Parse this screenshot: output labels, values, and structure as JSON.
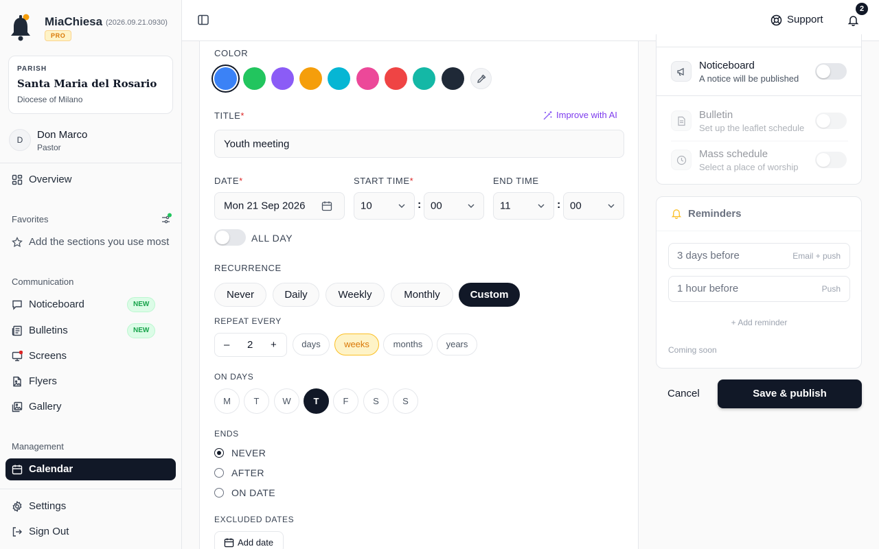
{
  "app": {
    "name": "MiaChiesa",
    "version": "(2026.09.21.0930)",
    "plan_badge": "PRO"
  },
  "parish": {
    "kicker": "PARISH",
    "name": "Santa Maria del Rosario",
    "diocese": "Diocese of Milano"
  },
  "user": {
    "initial": "D",
    "name": "Don Marco",
    "role": "Pastor"
  },
  "nav": {
    "overview": "Overview",
    "favorites_label": "Favorites",
    "favorites_placeholder": "Add the sections you use most",
    "communication_label": "Communication",
    "communication": [
      {
        "label": "Noticeboard",
        "badge": "NEW"
      },
      {
        "label": "Bulletins",
        "badge": "NEW"
      },
      {
        "label": "Screens",
        "badge": ""
      },
      {
        "label": "Flyers",
        "badge": ""
      },
      {
        "label": "Gallery",
        "badge": ""
      }
    ],
    "management_label": "Management",
    "calendar": "Calendar",
    "settings": "Settings",
    "sign_out": "Sign Out"
  },
  "topbar": {
    "support": "Support",
    "notification_count": "2"
  },
  "form": {
    "color_label": "COLOR",
    "colors": [
      "#3b82f6",
      "#22c55e",
      "#8b5cf6",
      "#f59e0b",
      "#06b6d4",
      "#ec4899",
      "#ef4444",
      "#14b8a6",
      "#1f2937"
    ],
    "selected_color": "#3b82f6",
    "title_label": "TITLE",
    "improve_ai": "Improve with AI",
    "title_value": "Youth meeting",
    "date_label": "DATE",
    "date_value": "Mon 21 Sep 2026",
    "start_time_label": "START TIME",
    "start_hour": "10",
    "start_minute": "00",
    "end_time_label": "END TIME",
    "end_hour": "11",
    "end_minute": "00",
    "all_day_label": "ALL DAY",
    "all_day": false,
    "recurrence_label": "RECURRENCE",
    "recurrence_options": [
      "Never",
      "Daily",
      "Weekly",
      "Monthly",
      "Custom"
    ],
    "recurrence_selected": "Custom",
    "repeat_every_label": "REPEAT EVERY",
    "repeat_interval": "2",
    "repeat_minus": "–",
    "repeat_plus": "+",
    "repeat_units": [
      "days",
      "weeks",
      "months",
      "years"
    ],
    "repeat_unit_selected": "weeks",
    "on_days_label": "ON DAYS",
    "days": [
      "M",
      "T",
      "W",
      "T",
      "F",
      "S",
      "S"
    ],
    "day_selected_index": 3,
    "ends_label": "ENDS",
    "ends_options": [
      "NEVER",
      "AFTER",
      "ON DATE"
    ],
    "ends_selected": "NEVER",
    "excluded_dates_label": "EXCLUDED DATES",
    "add_date": "Add date"
  },
  "publish": {
    "noticeboard": {
      "title": "Noticeboard",
      "desc": "A notice will be published",
      "enabled": false
    },
    "bulletin": {
      "title": "Bulletin",
      "desc": "Set up the leaflet schedule",
      "enabled": false
    },
    "mass_schedule": {
      "title": "Mass schedule",
      "desc": "Select a place of worship",
      "enabled": false
    }
  },
  "reminders": {
    "title": "Reminders",
    "items": [
      {
        "text": "3 days before",
        "channel": "Email + push"
      },
      {
        "text": "1 hour before",
        "channel": "Push"
      }
    ],
    "add": "+ Add reminder",
    "coming_soon": "Coming soon"
  },
  "actions": {
    "cancel": "Cancel",
    "save": "Save & publish"
  }
}
